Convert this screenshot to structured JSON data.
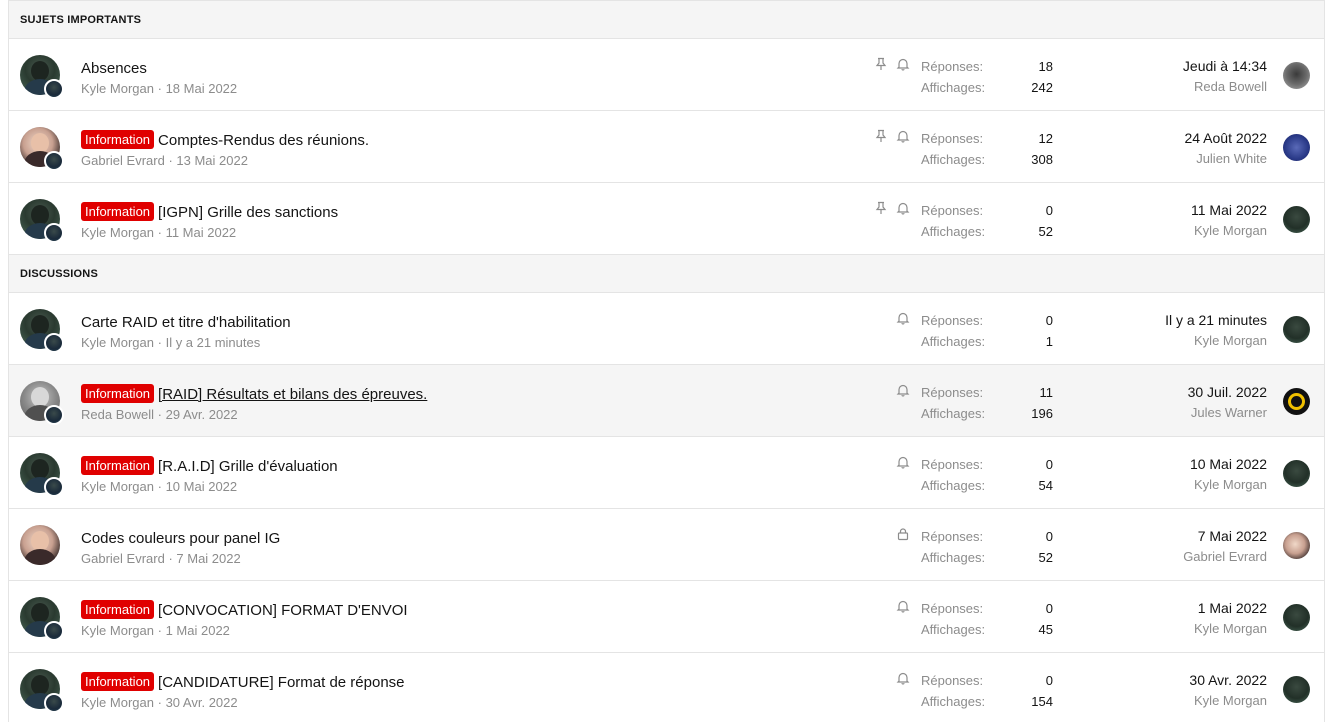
{
  "sections": [
    {
      "title": "SUJETS IMPORTANTS",
      "threads": [
        {
          "avatar": "kyle",
          "mini": true,
          "label": "",
          "title": "Absences",
          "author": "Kyle Morgan",
          "date": "18 Mai 2022",
          "icons": [
            "pin-icon",
            "bell-icon"
          ],
          "replies": "18",
          "views": "242",
          "last_date": "Jeudi à 14:34",
          "last_user": "Reda Bowell",
          "last_avatar": "reda"
        },
        {
          "avatar": "gab",
          "mini": true,
          "label": "Information",
          "title": "Comptes-Rendus des réunions.",
          "author": "Gabriel Evrard",
          "date": "13 Mai 2022",
          "icons": [
            "pin-icon",
            "bell-icon"
          ],
          "replies": "12",
          "views": "308",
          "last_date": "24 Août 2022",
          "last_user": "Julien White",
          "last_avatar": "julien"
        },
        {
          "avatar": "kyle",
          "mini": true,
          "label": "Information",
          "title": "[IGPN] Grille des sanctions",
          "author": "Kyle Morgan",
          "date": "11 Mai 2022",
          "icons": [
            "pin-icon",
            "bell-icon"
          ],
          "replies": "0",
          "views": "52",
          "last_date": "11 Mai 2022",
          "last_user": "Kyle Morgan",
          "last_avatar": "kyle"
        }
      ]
    },
    {
      "title": "DISCUSSIONS",
      "threads": [
        {
          "avatar": "kyle",
          "mini": true,
          "label": "",
          "title": "Carte RAID et titre d'habilitation",
          "author": "Kyle Morgan",
          "date": "Il y a 21 minutes",
          "icons": [
            "bell-icon"
          ],
          "replies": "0",
          "views": "1",
          "last_date": "Il y a 21 minutes",
          "last_user": "Kyle Morgan",
          "last_avatar": "kyle"
        },
        {
          "avatar": "reda",
          "mini": true,
          "label": "Information",
          "title": "[RAID] Résultats et bilans des épreuves.",
          "underline": true,
          "hover": true,
          "author": "Reda Bowell",
          "date": "29 Avr. 2022",
          "icons": [
            "bell-icon"
          ],
          "replies": "11",
          "views": "196",
          "last_date": "30 Juil. 2022",
          "last_user": "Jules Warner",
          "last_avatar": "jules"
        },
        {
          "avatar": "kyle",
          "mini": true,
          "label": "Information",
          "title": "[R.A.I.D] Grille d'évaluation",
          "author": "Kyle Morgan",
          "date": "10 Mai 2022",
          "icons": [
            "bell-icon"
          ],
          "replies": "0",
          "views": "54",
          "last_date": "10 Mai 2022",
          "last_user": "Kyle Morgan",
          "last_avatar": "kyle"
        },
        {
          "avatar": "gab",
          "mini": false,
          "label": "",
          "title": "Codes couleurs pour panel IG",
          "author": "Gabriel Evrard",
          "date": "7 Mai 2022",
          "icons": [
            "lock-icon"
          ],
          "replies": "0",
          "views": "52",
          "last_date": "7 Mai 2022",
          "last_user": "Gabriel Evrard",
          "last_avatar": "gab"
        },
        {
          "avatar": "kyle",
          "mini": true,
          "label": "Information",
          "title": "[CONVOCATION] FORMAT D'ENVOI",
          "author": "Kyle Morgan",
          "date": "1 Mai 2022",
          "icons": [
            "bell-icon"
          ],
          "replies": "0",
          "views": "45",
          "last_date": "1 Mai 2022",
          "last_user": "Kyle Morgan",
          "last_avatar": "kyle"
        },
        {
          "avatar": "kyle",
          "mini": true,
          "label": "Information",
          "title": "[CANDIDATURE] Format de réponse",
          "author": "Kyle Morgan",
          "date": "30 Avr. 2022",
          "icons": [
            "bell-icon"
          ],
          "replies": "0",
          "views": "154",
          "last_date": "30 Avr. 2022",
          "last_user": "Kyle Morgan",
          "last_avatar": "kyle"
        }
      ]
    }
  ],
  "labels": {
    "replies": "Réponses:",
    "views": "Affichages:",
    "sep": "·"
  },
  "colors": {
    "label_bg": "#e00000",
    "muted": "#8c8c8c",
    "section_bg": "#f5f5f5"
  }
}
